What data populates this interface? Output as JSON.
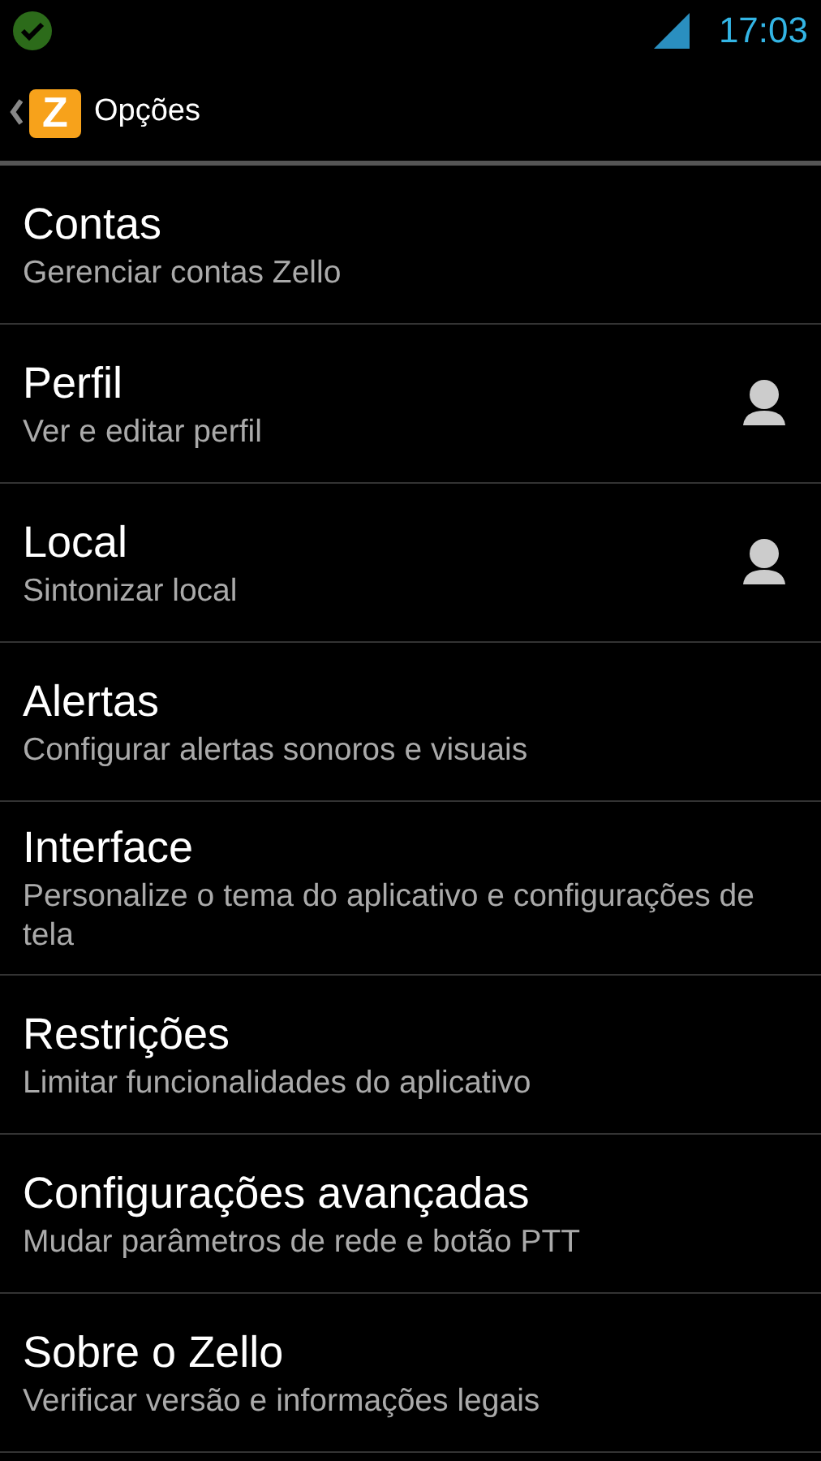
{
  "status_bar": {
    "time": "17:03"
  },
  "action_bar": {
    "logo_letter": "Z",
    "title": "Opções"
  },
  "items": [
    {
      "title": "Contas",
      "subtitle": "Gerenciar contas Zello",
      "kind": "plain"
    },
    {
      "title": "Perfil",
      "subtitle": "Ver e editar perfil",
      "kind": "profile"
    },
    {
      "title": "Local",
      "subtitle": "Sintonizar local",
      "kind": "profile"
    },
    {
      "title": "Alertas",
      "subtitle": "Configurar alertas sonoros e visuais",
      "kind": "plain"
    },
    {
      "title": "Interface",
      "subtitle": "Personalize o tema do aplicativo e configurações de tela",
      "kind": "plain"
    },
    {
      "title": "Restrições",
      "subtitle": "Limitar funcionalidades do aplicativo",
      "kind": "plain"
    },
    {
      "title": "Configurações avançadas",
      "subtitle": "Mudar parâmetros de rede e botão PTT",
      "kind": "plain"
    },
    {
      "title": "Sobre o Zello",
      "subtitle": "Verificar versão e informações legais",
      "kind": "plain"
    }
  ]
}
